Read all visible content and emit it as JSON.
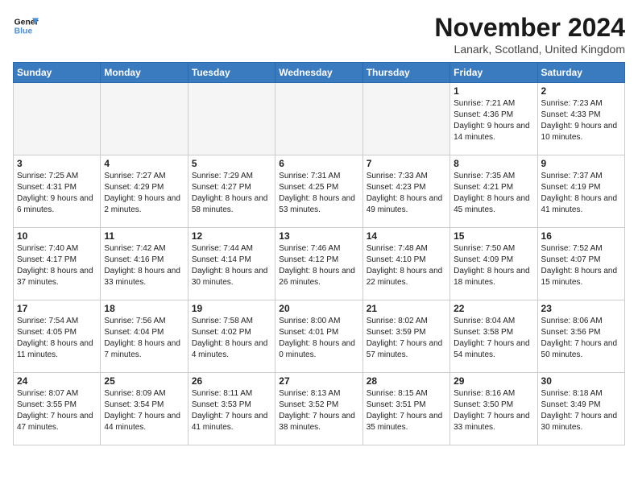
{
  "header": {
    "logo_line1": "General",
    "logo_line2": "Blue",
    "month": "November 2024",
    "location": "Lanark, Scotland, United Kingdom"
  },
  "days_of_week": [
    "Sunday",
    "Monday",
    "Tuesday",
    "Wednesday",
    "Thursday",
    "Friday",
    "Saturday"
  ],
  "weeks": [
    [
      {
        "day": "",
        "empty": true
      },
      {
        "day": "",
        "empty": true
      },
      {
        "day": "",
        "empty": true
      },
      {
        "day": "",
        "empty": true
      },
      {
        "day": "",
        "empty": true
      },
      {
        "day": "1",
        "sunrise": "Sunrise: 7:21 AM",
        "sunset": "Sunset: 4:36 PM",
        "daylight": "Daylight: 9 hours and 14 minutes."
      },
      {
        "day": "2",
        "sunrise": "Sunrise: 7:23 AM",
        "sunset": "Sunset: 4:33 PM",
        "daylight": "Daylight: 9 hours and 10 minutes."
      }
    ],
    [
      {
        "day": "3",
        "sunrise": "Sunrise: 7:25 AM",
        "sunset": "Sunset: 4:31 PM",
        "daylight": "Daylight: 9 hours and 6 minutes."
      },
      {
        "day": "4",
        "sunrise": "Sunrise: 7:27 AM",
        "sunset": "Sunset: 4:29 PM",
        "daylight": "Daylight: 9 hours and 2 minutes."
      },
      {
        "day": "5",
        "sunrise": "Sunrise: 7:29 AM",
        "sunset": "Sunset: 4:27 PM",
        "daylight": "Daylight: 8 hours and 58 minutes."
      },
      {
        "day": "6",
        "sunrise": "Sunrise: 7:31 AM",
        "sunset": "Sunset: 4:25 PM",
        "daylight": "Daylight: 8 hours and 53 minutes."
      },
      {
        "day": "7",
        "sunrise": "Sunrise: 7:33 AM",
        "sunset": "Sunset: 4:23 PM",
        "daylight": "Daylight: 8 hours and 49 minutes."
      },
      {
        "day": "8",
        "sunrise": "Sunrise: 7:35 AM",
        "sunset": "Sunset: 4:21 PM",
        "daylight": "Daylight: 8 hours and 45 minutes."
      },
      {
        "day": "9",
        "sunrise": "Sunrise: 7:37 AM",
        "sunset": "Sunset: 4:19 PM",
        "daylight": "Daylight: 8 hours and 41 minutes."
      }
    ],
    [
      {
        "day": "10",
        "sunrise": "Sunrise: 7:40 AM",
        "sunset": "Sunset: 4:17 PM",
        "daylight": "Daylight: 8 hours and 37 minutes."
      },
      {
        "day": "11",
        "sunrise": "Sunrise: 7:42 AM",
        "sunset": "Sunset: 4:16 PM",
        "daylight": "Daylight: 8 hours and 33 minutes."
      },
      {
        "day": "12",
        "sunrise": "Sunrise: 7:44 AM",
        "sunset": "Sunset: 4:14 PM",
        "daylight": "Daylight: 8 hours and 30 minutes."
      },
      {
        "day": "13",
        "sunrise": "Sunrise: 7:46 AM",
        "sunset": "Sunset: 4:12 PM",
        "daylight": "Daylight: 8 hours and 26 minutes."
      },
      {
        "day": "14",
        "sunrise": "Sunrise: 7:48 AM",
        "sunset": "Sunset: 4:10 PM",
        "daylight": "Daylight: 8 hours and 22 minutes."
      },
      {
        "day": "15",
        "sunrise": "Sunrise: 7:50 AM",
        "sunset": "Sunset: 4:09 PM",
        "daylight": "Daylight: 8 hours and 18 minutes."
      },
      {
        "day": "16",
        "sunrise": "Sunrise: 7:52 AM",
        "sunset": "Sunset: 4:07 PM",
        "daylight": "Daylight: 8 hours and 15 minutes."
      }
    ],
    [
      {
        "day": "17",
        "sunrise": "Sunrise: 7:54 AM",
        "sunset": "Sunset: 4:05 PM",
        "daylight": "Daylight: 8 hours and 11 minutes."
      },
      {
        "day": "18",
        "sunrise": "Sunrise: 7:56 AM",
        "sunset": "Sunset: 4:04 PM",
        "daylight": "Daylight: 8 hours and 7 minutes."
      },
      {
        "day": "19",
        "sunrise": "Sunrise: 7:58 AM",
        "sunset": "Sunset: 4:02 PM",
        "daylight": "Daylight: 8 hours and 4 minutes."
      },
      {
        "day": "20",
        "sunrise": "Sunrise: 8:00 AM",
        "sunset": "Sunset: 4:01 PM",
        "daylight": "Daylight: 8 hours and 0 minutes."
      },
      {
        "day": "21",
        "sunrise": "Sunrise: 8:02 AM",
        "sunset": "Sunset: 3:59 PM",
        "daylight": "Daylight: 7 hours and 57 minutes."
      },
      {
        "day": "22",
        "sunrise": "Sunrise: 8:04 AM",
        "sunset": "Sunset: 3:58 PM",
        "daylight": "Daylight: 7 hours and 54 minutes."
      },
      {
        "day": "23",
        "sunrise": "Sunrise: 8:06 AM",
        "sunset": "Sunset: 3:56 PM",
        "daylight": "Daylight: 7 hours and 50 minutes."
      }
    ],
    [
      {
        "day": "24",
        "sunrise": "Sunrise: 8:07 AM",
        "sunset": "Sunset: 3:55 PM",
        "daylight": "Daylight: 7 hours and 47 minutes."
      },
      {
        "day": "25",
        "sunrise": "Sunrise: 8:09 AM",
        "sunset": "Sunset: 3:54 PM",
        "daylight": "Daylight: 7 hours and 44 minutes."
      },
      {
        "day": "26",
        "sunrise": "Sunrise: 8:11 AM",
        "sunset": "Sunset: 3:53 PM",
        "daylight": "Daylight: 7 hours and 41 minutes."
      },
      {
        "day": "27",
        "sunrise": "Sunrise: 8:13 AM",
        "sunset": "Sunset: 3:52 PM",
        "daylight": "Daylight: 7 hours and 38 minutes."
      },
      {
        "day": "28",
        "sunrise": "Sunrise: 8:15 AM",
        "sunset": "Sunset: 3:51 PM",
        "daylight": "Daylight: 7 hours and 35 minutes."
      },
      {
        "day": "29",
        "sunrise": "Sunrise: 8:16 AM",
        "sunset": "Sunset: 3:50 PM",
        "daylight": "Daylight: 7 hours and 33 minutes."
      },
      {
        "day": "30",
        "sunrise": "Sunrise: 8:18 AM",
        "sunset": "Sunset: 3:49 PM",
        "daylight": "Daylight: 7 hours and 30 minutes."
      }
    ]
  ]
}
